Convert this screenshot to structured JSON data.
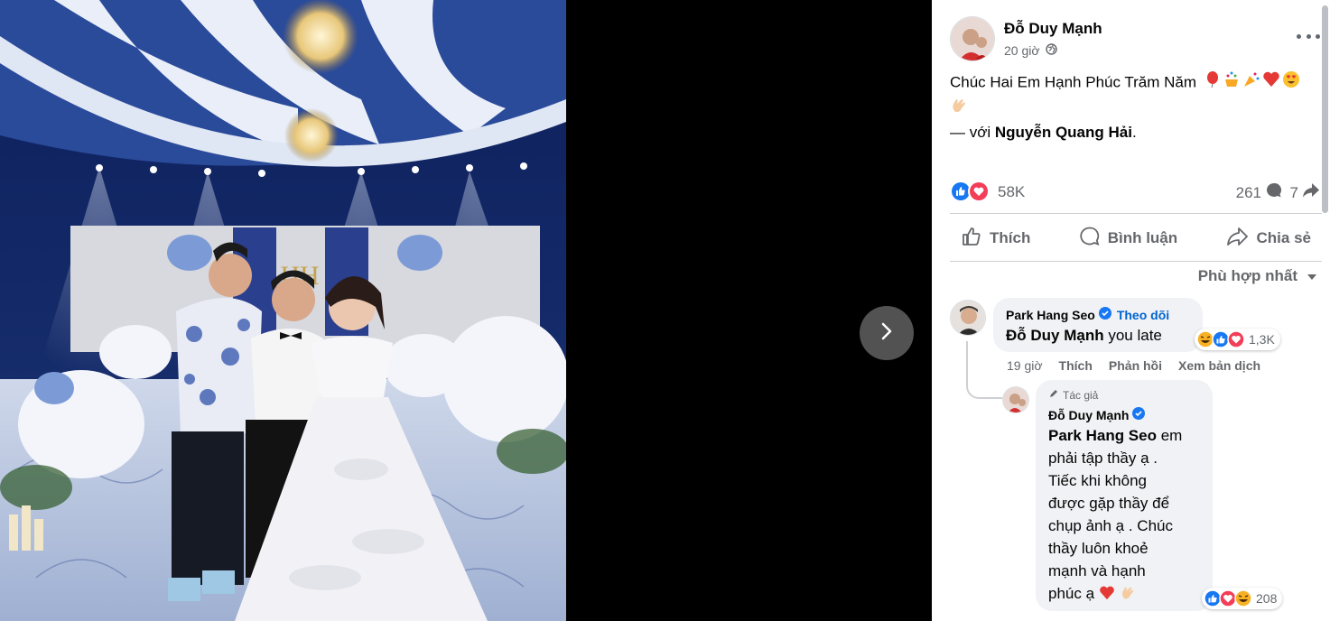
{
  "post": {
    "author": "Đỗ Duy Mạnh",
    "time": "20 giờ",
    "text": "Chúc Hai Em Hạnh Phúc Trăm Năm",
    "tag_prefix": "— với",
    "tag_name": "Nguyễn Quang Hải",
    "tag_suffix": ".",
    "reactions_count": "58K",
    "comments_count": "261",
    "shares_count": "7"
  },
  "actions": {
    "like": "Thích",
    "comment": "Bình luận",
    "share": "Chia sẻ"
  },
  "sort_label": "Phù hợp nhất",
  "comments": [
    {
      "author": "Park Hang Seo",
      "follow": "Theo dõi",
      "mention": "Đỗ Duy Mạnh",
      "text": " you late",
      "reactions": "1,3K",
      "time": "19 giờ",
      "like": "Thích",
      "reply": "Phản hồi",
      "translate": "Xem bản dịch"
    }
  ],
  "reply": {
    "badge": "Tác giả",
    "author": "Đỗ Duy Mạnh",
    "mention": "Park Hang Seo",
    "lines": [
      " em",
      "phải tập thầy ạ .",
      "Tiếc khi không",
      "được gặp thầy để",
      "chụp ảnh ạ . Chúc",
      "thầy luôn khoẻ",
      "mạnh và hạnh",
      "phúc ạ"
    ],
    "reactions": "208"
  },
  "colors": {
    "like_blue": "#1877f2",
    "love_red": "#f33e58",
    "haha_yellow": "#f7b125",
    "link_blue": "#0064d1",
    "secondary_text": "#65676b"
  }
}
